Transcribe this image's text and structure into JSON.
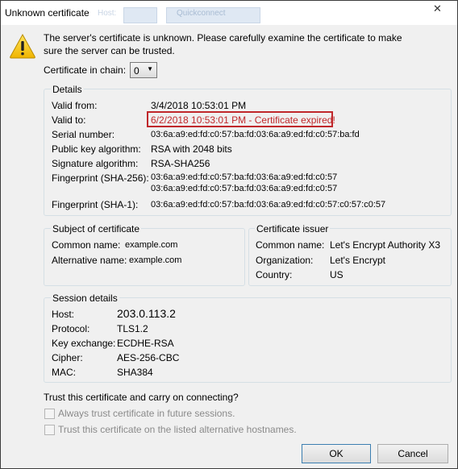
{
  "window": {
    "title": "Unknown certificate",
    "close_glyph": "✕",
    "ghost": {
      "a": "Host:",
      "b": "Quickconnect"
    }
  },
  "message": "The server's certificate is unknown. Please carefully examine the certificate to make sure the server can be trusted.",
  "chain": {
    "label": "Certificate in chain:",
    "value": "0"
  },
  "details": {
    "title": "Details",
    "valid_from_label": "Valid from:",
    "valid_from": "3/4/2018 10:53:01 PM",
    "valid_to_label": "Valid to:",
    "valid_to": "6/2/2018 10:53:01 PM - Certificate expired!",
    "serial_label": "Serial number:",
    "serial": "03:6a:a9:ed:fd:c0:57:ba:fd:03:6a:a9:ed:fd:c0:57:ba:fd",
    "pubkey_label": "Public key algorithm:",
    "pubkey": "RSA with 2048 bits",
    "sigalg_label": "Signature algorithm:",
    "sigalg": "RSA-SHA256",
    "fp256_label": "Fingerprint (SHA-256):",
    "fp256_1": "03:6a:a9:ed:fd:c0:57:ba:fd:03:6a:a9:ed:fd:c0:57",
    "fp256_2": "03:6a:a9:ed:fd:c0:57:ba:fd:03:6a:a9:ed:fd:c0:57",
    "fp1_label": "Fingerprint (SHA-1):",
    "fp1": "03:6a:a9:ed:fd:c0:57:ba:fd:03:6a:a9:ed:fd:c0:57:c0:57:c0:57"
  },
  "subject": {
    "title": "Subject of certificate",
    "cn_label": "Common name:",
    "cn": "example.com",
    "alt_label": "Alternative name:",
    "alt": "example.com"
  },
  "issuer": {
    "title": "Certificate issuer",
    "cn_label": "Common name:",
    "cn": "Let's Encrypt Authority X3",
    "org_label": "Organization:",
    "org": "Let's Encrypt",
    "country_label": "Country:",
    "country": "US"
  },
  "session": {
    "title": "Session details",
    "host_label": "Host:",
    "host": "203.0.113.2",
    "protocol_label": "Protocol:",
    "protocol": "TLS1.2",
    "kex_label": "Key exchange:",
    "kex": "ECDHE-RSA",
    "cipher_label": "Cipher:",
    "cipher": "AES-256-CBC",
    "mac_label": "MAC:",
    "mac": "SHA384"
  },
  "trust": {
    "question": "Trust this certificate and carry on connecting?",
    "always": "Always trust certificate in future sessions.",
    "alt_hosts": "Trust this certificate on the listed alternative hostnames."
  },
  "buttons": {
    "ok": "OK",
    "cancel": "Cancel"
  }
}
